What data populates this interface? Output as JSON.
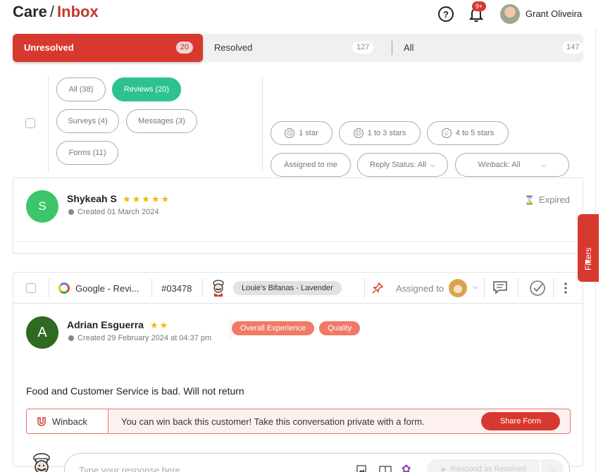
{
  "header": {
    "breadcrumb_root": "Care",
    "breadcrumb_separator": "/",
    "breadcrumb_current": "Inbox",
    "notification_badge": "9+",
    "user_name": "Grant Oliveira"
  },
  "status_tabs": [
    {
      "label": "Unresolved",
      "count": "20"
    },
    {
      "label": "Resolved",
      "count": "127"
    },
    {
      "label": "All",
      "count": "147"
    }
  ],
  "type_filters": {
    "all": "All (38)",
    "reviews": "Reviews (20)",
    "surveys": "Surveys (4)",
    "messages": "Messages (3)",
    "forms": "Forms (11)"
  },
  "rating_filters": {
    "one_star": "1 star",
    "one_to_three": "1 to 3 stars",
    "four_to_five": "4 to 5 stars"
  },
  "other_filters": {
    "assigned_to_me": "Assigned to me",
    "reply_status": "Reply Status: All",
    "winback": "Winback: All"
  },
  "filters_tab_label": "Filters",
  "reviews": [
    {
      "avatar_letter": "S",
      "name": "Shykeah S",
      "rating": 5,
      "stars": "★★★★★",
      "created": "Created 01 March 2024",
      "status": "Expired",
      "avatar_color": "#3cc56b"
    },
    {
      "avatar_letter": "A",
      "name": "Adrian Esguerra",
      "rating": 2,
      "stars": "★★",
      "created": "Created 29 February 2024 at 04:37 pm",
      "source": "Google - Revi...",
      "ticket_id": "#03478",
      "location": "Louie's Bifanas - Lavender",
      "assigned_label": "Assigned to",
      "tags": [
        "Overall Experience",
        "Quality"
      ],
      "text": "Food and Customer Service is bad. Will not return",
      "winback": {
        "label": "Winback",
        "message": "You can win back this customer! Take this conversation private with a form.",
        "button": "Share Form"
      },
      "response_placeholder": "Type your response here",
      "respond_button": "Respond as Resolved",
      "avatar_color": "#2e6a1f"
    }
  ],
  "colors": {
    "accent_red": "#d8392f",
    "active_green": "#2dc28f",
    "star_yellow": "#f5b50a",
    "tag_salmon": "#f07a67"
  }
}
